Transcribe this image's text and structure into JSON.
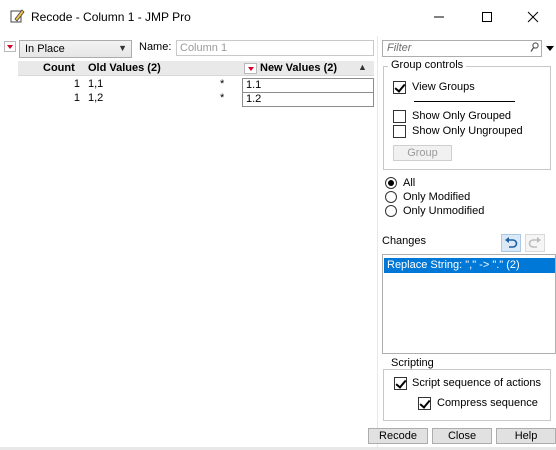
{
  "window": {
    "title": "Recode - Column 1 - JMP Pro"
  },
  "left": {
    "mode_select": "In Place",
    "name_label": "Name:",
    "name_placeholder": "Column 1",
    "table": {
      "headers": {
        "count": "Count",
        "old": "Old Values (2)",
        "new": "New Values (2)"
      },
      "rows": [
        {
          "count": "1",
          "old": "1,1",
          "flag": "*",
          "new": "1.1"
        },
        {
          "count": "1",
          "old": "1,2",
          "flag": "*",
          "new": "1.2"
        }
      ]
    }
  },
  "right": {
    "filter_placeholder": "Filter",
    "group_controls": {
      "legend": "Group controls",
      "view_groups": {
        "label": "View Groups",
        "checked": true
      },
      "show_only_grouped": {
        "label": "Show Only Grouped",
        "checked": false
      },
      "show_only_ungrouped": {
        "label": "Show Only Ungrouped",
        "checked": false
      },
      "group_button": "Group"
    },
    "filter_radios": {
      "selected": "All",
      "options": [
        "All",
        "Only Modified",
        "Only Unmodified"
      ]
    },
    "changes": {
      "label": "Changes",
      "items": [
        "Replace String: \",\" -> \".\" (2)"
      ]
    },
    "scripting": {
      "legend": "Scripting",
      "script_sequence": {
        "label": "Script sequence of actions",
        "checked": true
      },
      "compress_sequence": {
        "label": "Compress sequence",
        "checked": true
      }
    }
  },
  "footer": {
    "recode": "Recode",
    "close": "Close",
    "help": "Help"
  },
  "colors": {
    "selection": "#0078d7",
    "accent_red": "#d4002a"
  }
}
